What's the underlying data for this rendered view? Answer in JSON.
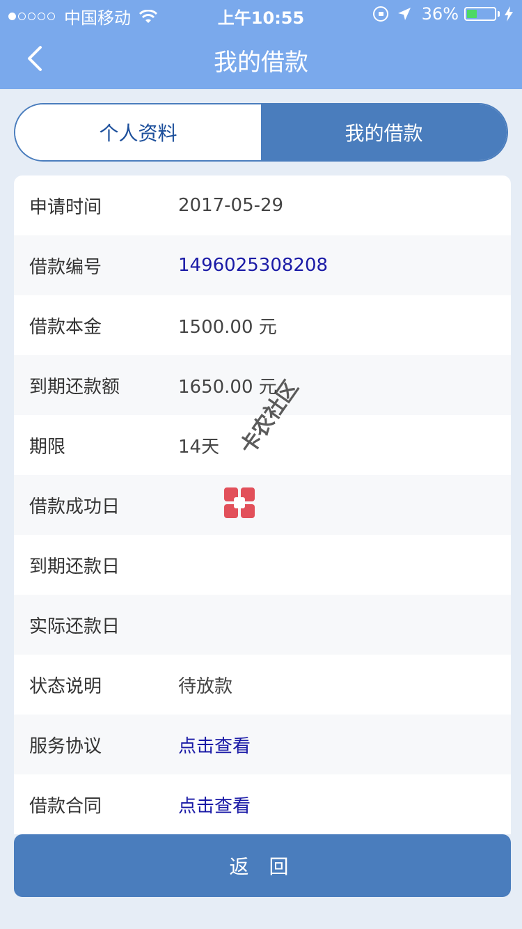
{
  "status_bar": {
    "carrier": "中国移动",
    "time": "上午10:55",
    "battery_percent": "36%",
    "battery_level": 0.36
  },
  "nav": {
    "title": "我的借款",
    "back_icon": "chevron-left-icon"
  },
  "tabs": [
    {
      "label": "个人资料",
      "active": false
    },
    {
      "label": "我的借款",
      "active": true
    }
  ],
  "details": [
    {
      "label": "申请时间",
      "value": "2017-05-29",
      "link": false
    },
    {
      "label": "借款编号",
      "value": "1496025308208",
      "link": true
    },
    {
      "label": "借款本金",
      "value": "1500.00 元",
      "link": false
    },
    {
      "label": "到期还款额",
      "value": "1650.00 元",
      "link": false
    },
    {
      "label": "期限",
      "value": "14天",
      "link": false
    },
    {
      "label": "借款成功日",
      "value": "",
      "link": false
    },
    {
      "label": "到期还款日",
      "value": "",
      "link": false
    },
    {
      "label": "实际还款日",
      "value": "",
      "link": false
    },
    {
      "label": "状态说明",
      "value": "待放款",
      "link": false
    },
    {
      "label": "服务协议",
      "value": "点击查看",
      "link": true
    },
    {
      "label": "借款合同",
      "value": "点击查看",
      "link": true
    }
  ],
  "return_button": "返 回",
  "watermark": {
    "text": "卡农社区"
  },
  "colors": {
    "nav_bg": "#7aa9ec",
    "primary": "#4a7dbd",
    "link": "#1a1aa6",
    "page_bg": "#e6edf6"
  }
}
